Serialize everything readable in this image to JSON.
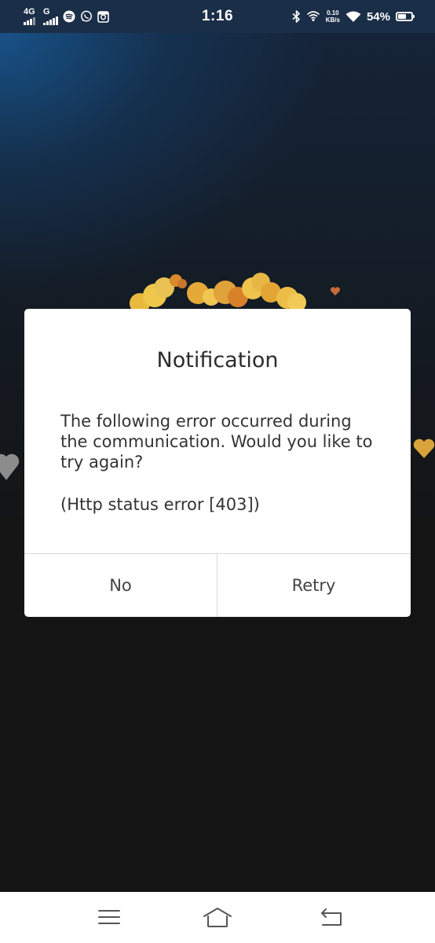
{
  "status_bar": {
    "time": "1:16",
    "network_1": "4G",
    "network_2": "G",
    "data_speed_value": "0.10",
    "data_speed_unit": "KB/s",
    "battery_percent": "54%",
    "battery_level": 0.54
  },
  "dialog": {
    "title": "Notification",
    "message": "The following error occurred during the communication. Would you like to try again?",
    "status": "(Http status error [403])",
    "buttons": {
      "no": "No",
      "retry": "Retry"
    }
  },
  "nav_bar": {
    "icons": [
      "menu-icon",
      "home-icon",
      "back-icon"
    ]
  },
  "colors": {
    "dialog_bg": "#ffffff",
    "text": "#333333",
    "background": "#141414",
    "accent_blue": "#18548c",
    "decor_gold": "#e9b23a"
  }
}
